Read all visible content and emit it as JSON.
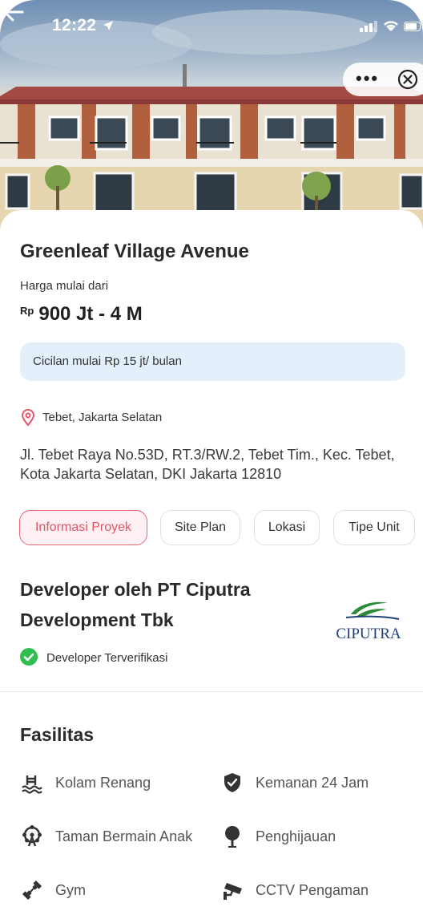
{
  "status_bar": {
    "time": "12:22"
  },
  "project": {
    "name": "Greenleaf Village Avenue",
    "price_label": "Harga mulai dari",
    "currency": "Rp",
    "price_range": "900 Jt - 4 M",
    "installment": "Cicilan mulai Rp 15 jt/ bulan",
    "area": "Tebet, Jakarta Selatan",
    "address": "Jl. Tebet Raya No.53D, RT.3/RW.2, Tebet Tim., Kec. Tebet, Kota Jakarta Selatan, DKI Jakarta 12810"
  },
  "tabs": [
    {
      "label": "Informasi Proyek",
      "active": true
    },
    {
      "label": "Site Plan",
      "active": false
    },
    {
      "label": "Lokasi",
      "active": false
    },
    {
      "label": "Tipe Unit",
      "active": false
    }
  ],
  "developer": {
    "title": "Developer oleh PT Ciputra Development Tbk",
    "logo_text": "CIPUTRA",
    "verified_label": "Developer Terverifikasi"
  },
  "facilities": {
    "title": "Fasilitas",
    "items": [
      {
        "label": "Kolam Renang",
        "icon": "swimming-pool-icon"
      },
      {
        "label": "Kemanan 24 Jam",
        "icon": "security-shield-icon"
      },
      {
        "label": "Taman Bermain Anak",
        "icon": "ferris-wheel-icon"
      },
      {
        "label": "Penghijauan",
        "icon": "tree-icon"
      },
      {
        "label": "Gym",
        "icon": "dumbbell-icon"
      },
      {
        "label": "CCTV Pengaman",
        "icon": "cctv-icon"
      }
    ]
  },
  "colors": {
    "accent_pink": "#e8667a",
    "installment_bg": "#e4effc",
    "verified_green": "#2fbf4e",
    "location_pin": "#e5566c",
    "ciputra_blue": "#1f3f7a",
    "ciputra_green": "#2e8b3a"
  }
}
